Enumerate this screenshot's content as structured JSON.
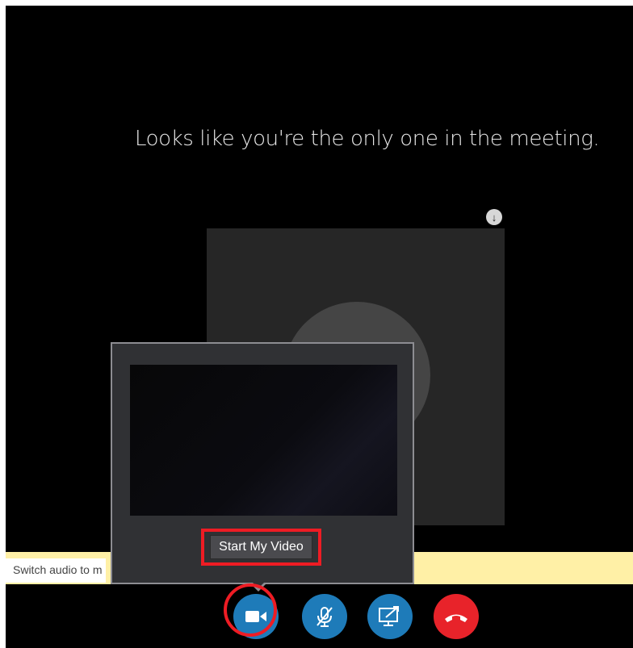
{
  "meeting": {
    "message": "Looks like you're the only one in the meeting."
  },
  "notification": {
    "text": "Switch audio to m"
  },
  "video_popup": {
    "start_video_label": "Start My Video"
  },
  "controls": {
    "items": [
      {
        "name": "video",
        "icon": "video-camera-icon",
        "color": "#1e7bb9",
        "highlighted": true
      },
      {
        "name": "microphone",
        "icon": "microphone-muted-icon",
        "color": "#1e7bb9"
      },
      {
        "name": "share",
        "icon": "present-screen-icon",
        "color": "#1e7bb9"
      },
      {
        "name": "hang-up",
        "icon": "phone-hangup-icon",
        "color": "#e8232a"
      }
    ]
  },
  "colors": {
    "background": "#000000",
    "accent": "#1e7bb9",
    "hangup": "#e8232a",
    "highlight": "#ee1c24",
    "notification_bar": "#fff0a6"
  }
}
